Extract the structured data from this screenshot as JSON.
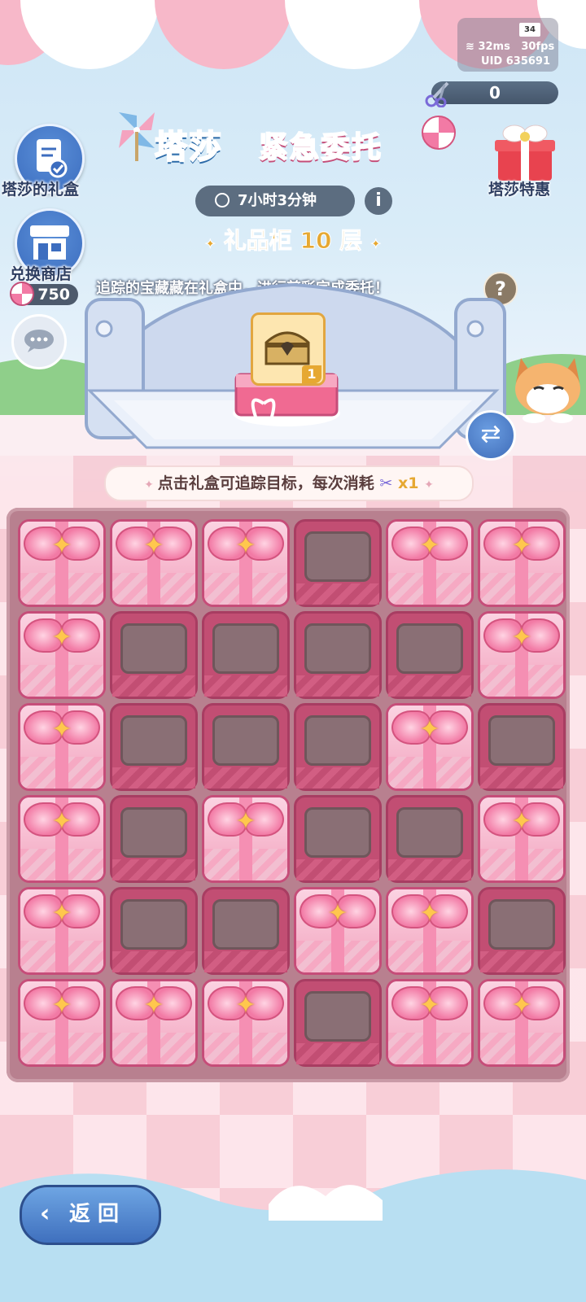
{
  "status": {
    "battery": "34",
    "ping": "32ms",
    "fps": "30fps",
    "uid": "UID 635691"
  },
  "scissors": {
    "count": "0"
  },
  "left_menu": {
    "gift_box_label": "塔莎的礼盒",
    "shop_label": "兑换商店",
    "candy_count": "750"
  },
  "right_menu": {
    "special_label": "塔莎特惠"
  },
  "event": {
    "title_part1": "塔莎",
    "title_part2": "紧急委托",
    "timer": "7小时3分钟",
    "info_icon": "i",
    "floor_prefix": "礼品柜",
    "floor_number": "10",
    "floor_suffix": "层",
    "hint": "追踪的宝藏藏在礼盒中，进行剪彩完成委托！",
    "help_icon": "?"
  },
  "target": {
    "count": "1"
  },
  "tip": {
    "text": "点击礼盒可追踪目标，每次消耗",
    "cost": "x1"
  },
  "board": {
    "rows": [
      [
        "gift",
        "gift",
        "gift",
        "empty",
        "gift",
        "gift"
      ],
      [
        "gift",
        "empty",
        "empty",
        "empty",
        "empty",
        "gift"
      ],
      [
        "gift",
        "empty",
        "empty",
        "empty",
        "gift",
        "empty"
      ],
      [
        "gift",
        "empty",
        "gift",
        "empty",
        "empty",
        "gift"
      ],
      [
        "gift",
        "empty",
        "empty",
        "gift",
        "gift",
        "empty"
      ],
      [
        "gift",
        "gift",
        "gift",
        "empty",
        "gift",
        "gift"
      ]
    ]
  },
  "back": {
    "label": "返 回"
  },
  "colors": {
    "accent_pink": "#f07aa6",
    "accent_blue": "#3b9be0",
    "board": "#b8808f"
  }
}
